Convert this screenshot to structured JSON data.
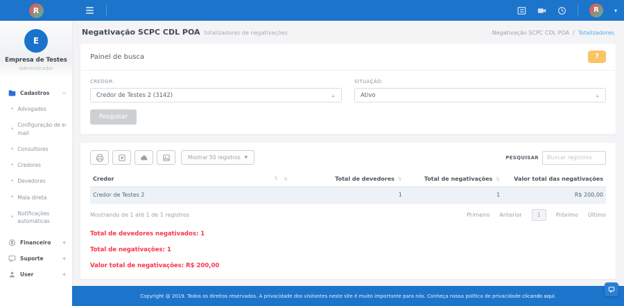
{
  "colors": {
    "primary": "#1d74cb",
    "danger_text": "#f8354c",
    "help_button": "#f9c463",
    "link": "#54a7e9",
    "row_stripe": "#edf2f8"
  },
  "topbar": {
    "icons": [
      "checklist-icon",
      "camera-icon",
      "clock-icon"
    ],
    "avatar_letter": "R",
    "caret": "▾"
  },
  "sidebar": {
    "profile": {
      "initial": "E",
      "name": "Empresa de Testes",
      "role": "Administrador"
    },
    "menu": {
      "cadastros": {
        "label": "Cadastros",
        "toggle": "−",
        "items": [
          "Advogados",
          "Configuração de e-mail",
          "Consultores",
          "Credores",
          "Devedores",
          "Mala direta",
          "Notificações automáticas"
        ]
      },
      "others": [
        {
          "label": "Financeiro",
          "toggle": "+"
        },
        {
          "label": "Suporte",
          "toggle": "+"
        },
        {
          "label": "User",
          "toggle": "+"
        }
      ]
    }
  },
  "page": {
    "title": "Negativação SCPC CDL POA",
    "subtitle": "totalizadores de negativações",
    "breadcrumb": {
      "parent": "Negativação SCPC CDL POA",
      "separator": "/",
      "current": "Totalizadores"
    }
  },
  "search_panel": {
    "title": "Painel de busca",
    "help_label": "?",
    "credor_label": "CREDOR:",
    "credor_value": "Credor de Testes 2 (3142)",
    "situacao_label": "SITUAÇÃO:",
    "situacao_value": "Ativo",
    "submit_label": "Pesquisar",
    "chevron": "⌄"
  },
  "table_panel": {
    "toolbar_icons": [
      "print-icon",
      "copy-icon",
      "cloud-icon",
      "pdf-icon"
    ],
    "length_label": "Mostrar 50 registros",
    "search_label": "PESQUISAR",
    "search_placeholder": "Buscar registros",
    "sort_glyph": "⇅",
    "headers": [
      "Credor",
      "Total de devedores",
      "Total de negativações",
      "Valor total das negativações"
    ],
    "row": {
      "credor": "Credor de Testes 2",
      "devedores": "1",
      "negativacoes": "1",
      "valor": "R$ 200,00"
    },
    "info": "Mostrando de 1 até 1 de 1 registros",
    "pagination": {
      "first": "Primeiro",
      "prev": "Anterior",
      "page": "1",
      "next": "Próximo",
      "last": "Último"
    }
  },
  "totals": {
    "devedores": "Total de devedores negativados: 1",
    "negativacoes": "Total de negativações: 1",
    "valor": "Valor total de negativações: R$ 200,00"
  },
  "footer": {
    "text": "Copyright @ 2019. Todos os direitos reservados. A privacidade dos visitantes neste site é muito importante para nós. Conheça nossa política de privacidade ",
    "link_text": "clicando aqui."
  }
}
